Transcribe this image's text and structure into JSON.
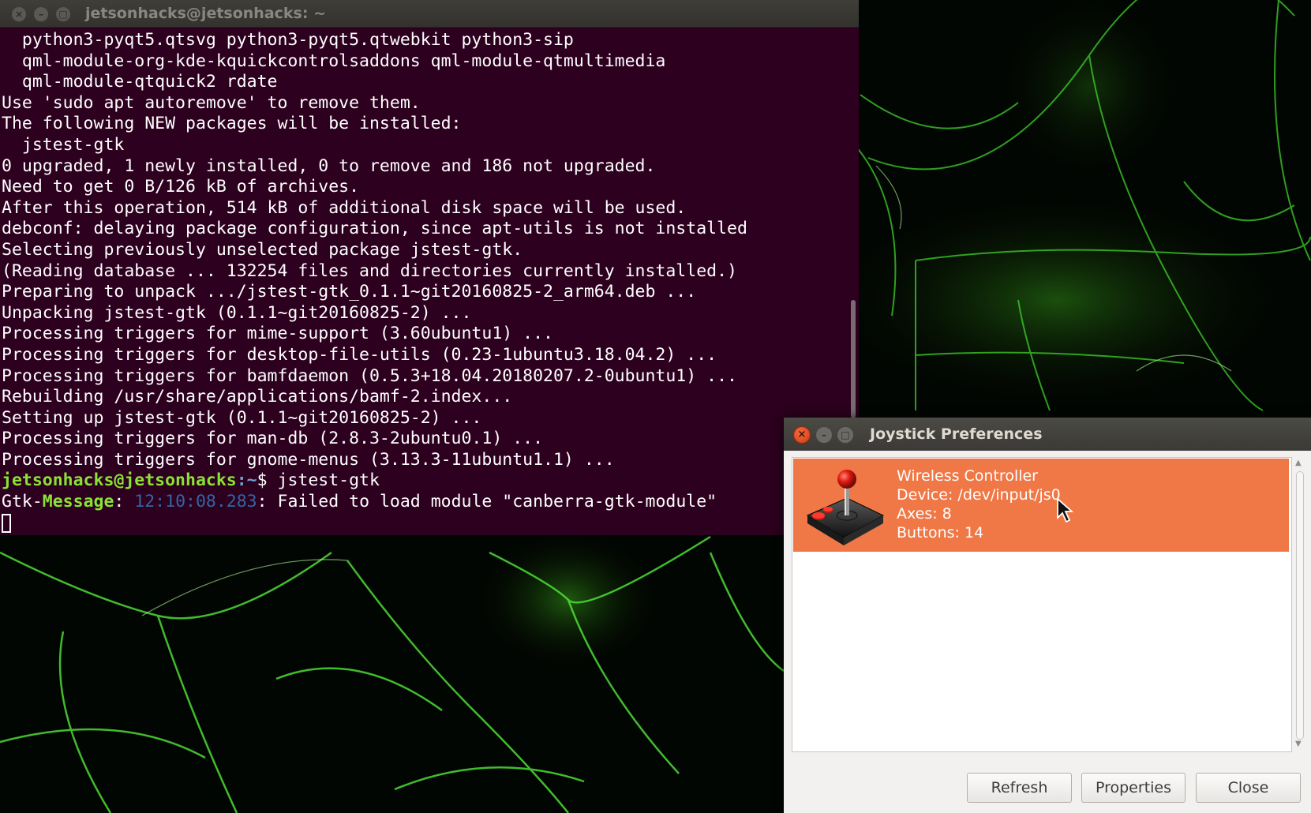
{
  "terminal": {
    "title": "jetsonhacks@jetsonhacks: ~",
    "lines": [
      "  python3-pyqt5.qtsvg python3-pyqt5.qtwebkit python3-sip",
      "  qml-module-org-kde-kquickcontrolsaddons qml-module-qtmultimedia",
      "  qml-module-qtquick2 rdate",
      "Use 'sudo apt autoremove' to remove them.",
      "The following NEW packages will be installed:",
      "  jstest-gtk",
      "0 upgraded, 1 newly installed, 0 to remove and 186 not upgraded.",
      "Need to get 0 B/126 kB of archives.",
      "After this operation, 514 kB of additional disk space will be used.",
      "debconf: delaying package configuration, since apt-utils is not installed",
      "Selecting previously unselected package jstest-gtk.",
      "(Reading database ... 132254 files and directories currently installed.)",
      "Preparing to unpack .../jstest-gtk_0.1.1~git20160825-2_arm64.deb ...",
      "Unpacking jstest-gtk (0.1.1~git20160825-2) ...",
      "Processing triggers for mime-support (3.60ubuntu1) ...",
      "Processing triggers for desktop-file-utils (0.23-1ubuntu3.18.04.2) ...",
      "Processing triggers for bamfdaemon (0.5.3+18.04.20180207.2-0ubuntu1) ...",
      "Rebuilding /usr/share/applications/bamf-2.index...",
      "Setting up jstest-gtk (0.1.1~git20160825-2) ...",
      "Processing triggers for man-db (2.8.3-2ubuntu0.1) ...",
      "Processing triggers for gnome-menus (3.13.3-11ubuntu1.1) ..."
    ],
    "prompt": {
      "user_host": "jetsonhacks@jetsonhacks",
      "path": ":~",
      "symbol": "$ ",
      "command": "jstest-gtk"
    },
    "gtk_message": {
      "prefix_a": "Gtk",
      "dash": "-",
      "prefix_b": "Message",
      "colon": ": ",
      "time": "12:10:08.283",
      "text": ": Failed to load module \"canberra-gtk-module\""
    }
  },
  "dialog": {
    "title": "Joystick Preferences",
    "device": {
      "name": "Wireless Controller",
      "device_path": "Device: /dev/input/js0",
      "axes": "Axes: 8",
      "buttons": "Buttons: 14"
    },
    "buttons": {
      "refresh": "Refresh",
      "properties": "Properties",
      "close": "Close"
    }
  },
  "icons": {
    "joystick": "joystick-icon",
    "pointer": "mouse-pointer-icon"
  },
  "colors": {
    "terminal_bg": "#2c001e",
    "selection": "#f07746",
    "prompt_green": "#8ae234",
    "prompt_blue": "#729fcf"
  }
}
